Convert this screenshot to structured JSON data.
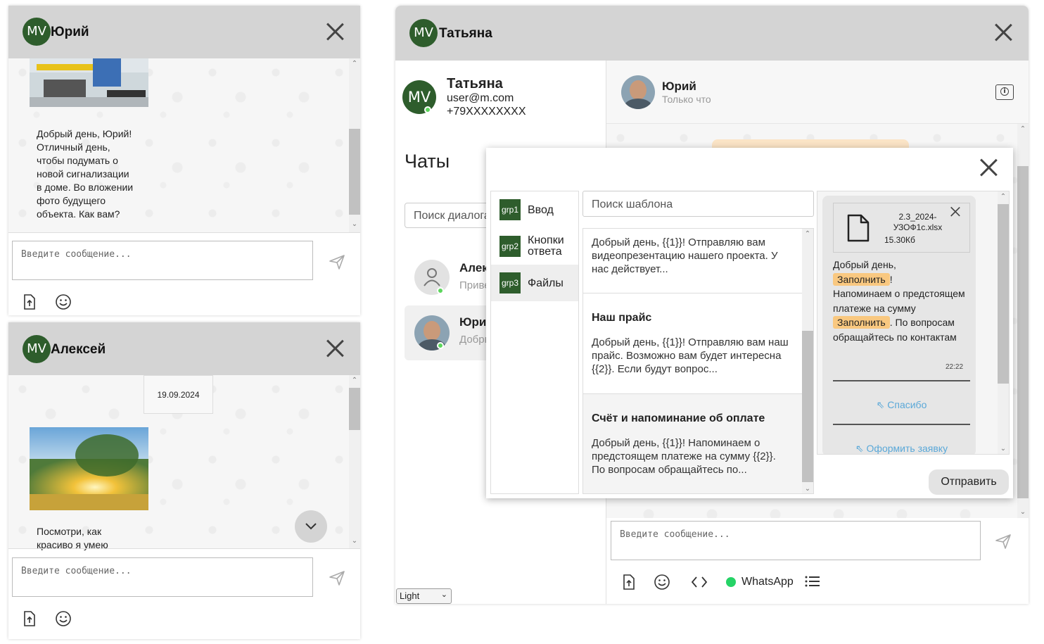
{
  "avatar_initials": "MV",
  "colors": {
    "brand_green": "#2e5d2c",
    "online": "#5cd65c",
    "chip": "#f9c880",
    "header": "#d4d4d4",
    "quick_reply": "#5aa8d8"
  },
  "widget1": {
    "title": "Юрий",
    "message": "Добрый день, Юрий!\nОтличный день,\nчтобы подумать о\nновой сигнализации\nв доме. Во вложении\nфото будущего\nобъекта. Как вам?",
    "input_placeholder": "Введите сообщение..."
  },
  "widget2": {
    "title": "Алексей",
    "date": "19.09.2024",
    "message": "Посмотри, как\nкрасиво я умею",
    "input_placeholder": "Введите сообщение..."
  },
  "main": {
    "title": "Татьяна",
    "profile": {
      "name": "Татьяна",
      "email": "user@m.com",
      "phone": "+79XXXXXXXX"
    },
    "chats_heading": "Чаты",
    "search_placeholder": "Поиск диалога",
    "dialogs": [
      {
        "name": "Алексей",
        "preview": "Привет"
      },
      {
        "name": "Юрий",
        "preview": "Добрый день"
      }
    ],
    "theme_select": "Light",
    "chat_header": {
      "name": "Юрий",
      "status": "Только что"
    },
    "input_placeholder": "Введите сообщение...",
    "channel": "WhatsApp"
  },
  "templates_modal": {
    "groups": [
      {
        "badge": "grp1",
        "label": "Ввод"
      },
      {
        "badge": "grp2",
        "label": "Кнопки\nответа"
      },
      {
        "badge": "grp3",
        "label": "Файлы"
      }
    ],
    "search_placeholder": "Поиск шаблона",
    "templates": [
      {
        "title": "",
        "body": "Добрый день, {{1}}! Отправляю вам видеопрезентацию нашего проекта. У нас действует..."
      },
      {
        "title": "Наш прайс",
        "body": "Добрый день, {{1}}! Отправляю вам наш прайс. Возможно вам будет интересна {{2}}. Если будут вопрос..."
      },
      {
        "title": "Счёт и напоминание об оплате",
        "body": "Добрый день, {{1}}! Напоминаем о предстоящем платеже на сумму {{2}}. По вопросам обращайтесь по..."
      }
    ],
    "preview": {
      "file_name": "2.3_2024-\nУЗОФ1с.xlsx",
      "file_size": "15.30Кб",
      "text_1": "Добрый день,",
      "chip": "Заполнить",
      "text_2": "!",
      "text_3": "Напоминаем о предстоящем платеже на сумму",
      "text_4": ". По вопросам обращайтесь по контактам",
      "time": "22:22",
      "buttons": [
        "Спасибо",
        "Оформить заявку"
      ]
    },
    "send_label": "Отправить"
  }
}
